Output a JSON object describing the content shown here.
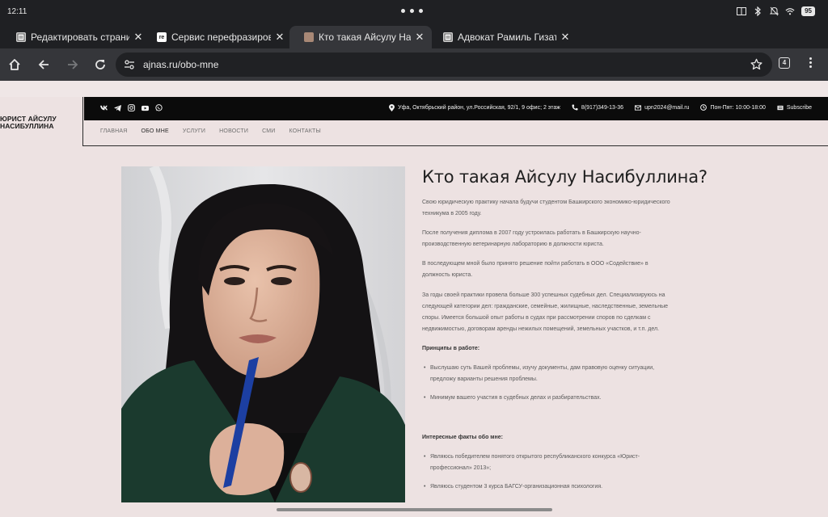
{
  "status_bar": {
    "time": "12:11",
    "battery": "95"
  },
  "tabs": [
    {
      "title": "Редактировать страницу \"О",
      "favicon": "doc-favicon",
      "active": false
    },
    {
      "title": "Сервис перефразирования",
      "favicon": "re-favicon",
      "favicon_text": "re",
      "active": false
    },
    {
      "title": "Кто такая Айсулу Насибулли",
      "favicon": "photo-favicon",
      "active": true
    },
    {
      "title": "Адвокат Рамиль Гизатулли",
      "favicon": "doc-favicon",
      "active": false
    }
  ],
  "toolbar": {
    "url": "ajnas.ru/obo-mne",
    "tab_count": "4"
  },
  "site": {
    "logo_line1": "ЮРИСТ АЙСУЛУ",
    "logo_line2": "НАСИБУЛЛИНА",
    "address": "Уфа, Октябрьский район, ул.Российская, 92/1, 9 офис; 2 этаж",
    "phone": "8(917)349-13-36",
    "email": "upn2024@mail.ru",
    "hours": "Пон-Пят: 10:00-18:00",
    "subscribe": "Subscribe",
    "nav": [
      "ГЛАВНАЯ",
      "ОБО МНЕ",
      "УСЛУГИ",
      "НОВОСТИ",
      "СМИ",
      "КОНТАКТЫ"
    ]
  },
  "article": {
    "title": "Кто такая Айсулу Насибуллина?",
    "p1_l1": "Свою юридическую практику начала будучи студентом Башкирского экономико-юридического",
    "p1_l2": "техникума в 2005 году.",
    "p2_l1": "После получения диплома в 2007 году устроилась работать в Башкирскую научно-",
    "p2_l2": "производственную ветеринарную лабораторию в должности юриста.",
    "p3_l1": "В последующем мной было принято решение пойти работать в ООО «Содействие» в",
    "p3_l2": "должность юриста.",
    "p4_l1": "За годы своей практики провела больше 300 успешных судебных дел. Специализируюсь на",
    "p4_l2": "следующей категории дел: гражданские, семейные, жилищные, наследственные, земельные",
    "p4_l3": "споры.   Имеется большой опыт работы в судах при рассмотрении споров по сделкам с",
    "p4_l4": "недвижимостью, договорам аренды нежилых помещений, земельных участков, и т.п. дел.",
    "principles_heading": "Принципы в работе:",
    "principle1_l1": "Выслушаю суть Вашей проблемы, изучу документы, дам правовую оценку ситуации,",
    "principle1_l2": "предложу варианты решения проблемы.",
    "principle2": "Минимум вашего участия в судебных делах и разбирательствах.",
    "facts_heading": "Интересные факты обо мне:",
    "fact1_l1": "Являюсь победителем понятого открытого республиканского конкурса «Юрист-",
    "fact1_l2": "профессионал» 2013»;",
    "fact2": "Являюсь студентом 3 курса БАГСУ-организационная психология."
  }
}
